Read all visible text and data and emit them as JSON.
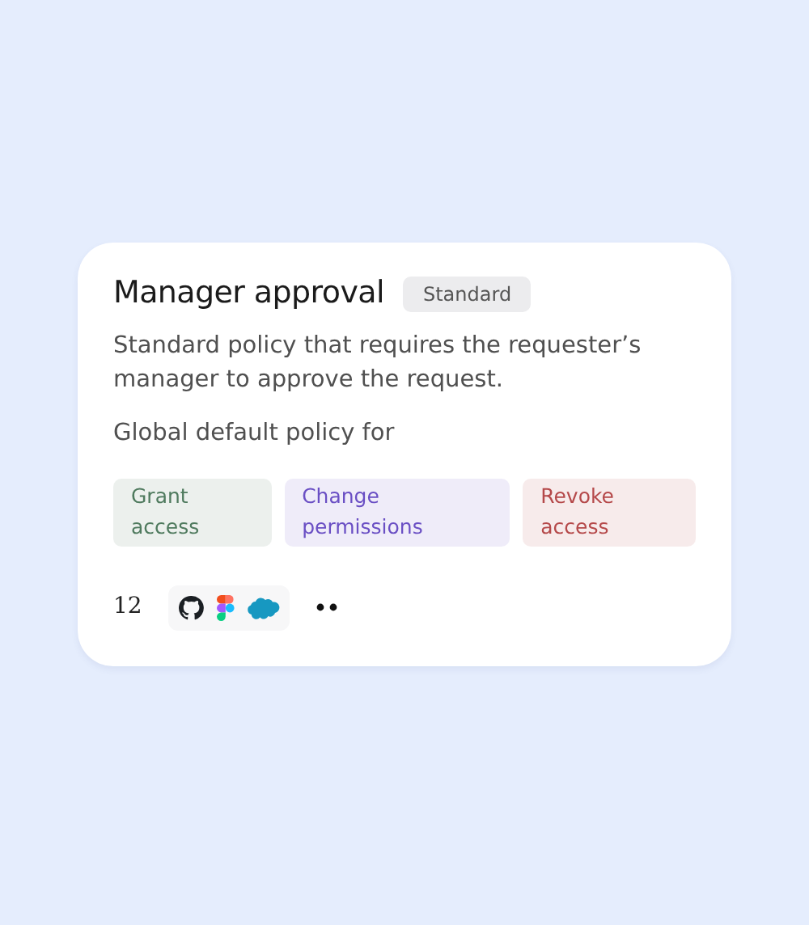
{
  "policy": {
    "title": "Manager approval",
    "badge": "Standard",
    "description": "Standard policy that requires the requester’s manager to approve the request.",
    "default_label": "Global default policy for",
    "tags": [
      {
        "label": "Grant access",
        "color": "#4f7a5e"
      },
      {
        "label": "Change permissions",
        "color": "#6a4fc4"
      },
      {
        "label": "Revoke access",
        "color": "#b5494a"
      }
    ],
    "count": "12",
    "apps": [
      {
        "kind": "cat"
      },
      {
        "kind": "shapes"
      },
      {
        "kind": "cloud"
      }
    ]
  }
}
